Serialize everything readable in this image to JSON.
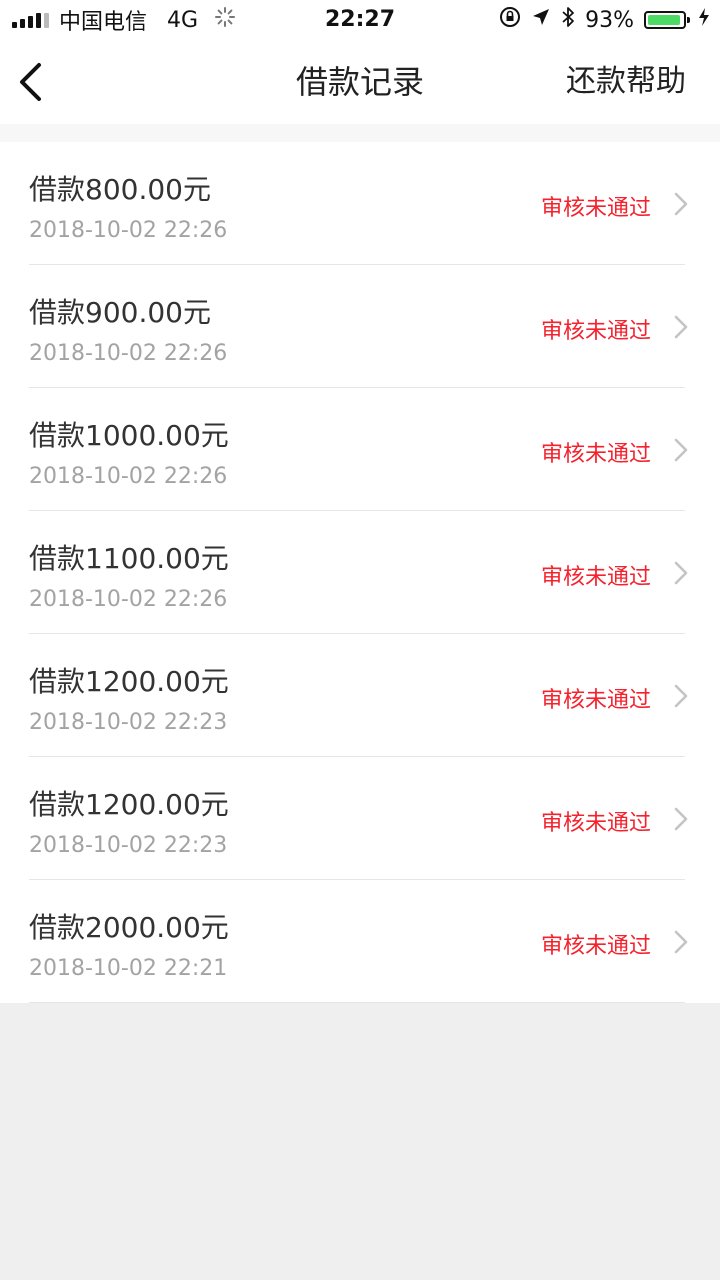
{
  "status_bar": {
    "carrier": "中国电信",
    "network": "4G",
    "time": "22:27",
    "battery_percent": "93%",
    "battery_level": 0.93,
    "battery_color": "#4cd964",
    "icons": [
      "signal-icon",
      "loading-icon",
      "orientation-lock-icon",
      "location-arrow-icon",
      "bluetooth-icon",
      "battery-icon",
      "charging-bolt-icon"
    ]
  },
  "nav": {
    "title": "借款记录",
    "right_action": "还款帮助",
    "back_icon": "chevron-left-icon"
  },
  "records": [
    {
      "amount": "借款800.00元",
      "time": "2018-10-02 22:26",
      "status": "审核未通过"
    },
    {
      "amount": "借款900.00元",
      "time": "2018-10-02 22:26",
      "status": "审核未通过"
    },
    {
      "amount": "借款1000.00元",
      "time": "2018-10-02 22:26",
      "status": "审核未通过"
    },
    {
      "amount": "借款1100.00元",
      "time": "2018-10-02 22:26",
      "status": "审核未通过"
    },
    {
      "amount": "借款1200.00元",
      "time": "2018-10-02 22:23",
      "status": "审核未通过"
    },
    {
      "amount": "借款1200.00元",
      "time": "2018-10-02 22:23",
      "status": "审核未通过"
    },
    {
      "amount": "借款2000.00元",
      "time": "2018-10-02 22:21",
      "status": "审核未通过"
    }
  ],
  "colors": {
    "status_rejected": "#f5222d",
    "background": "#efefef"
  }
}
